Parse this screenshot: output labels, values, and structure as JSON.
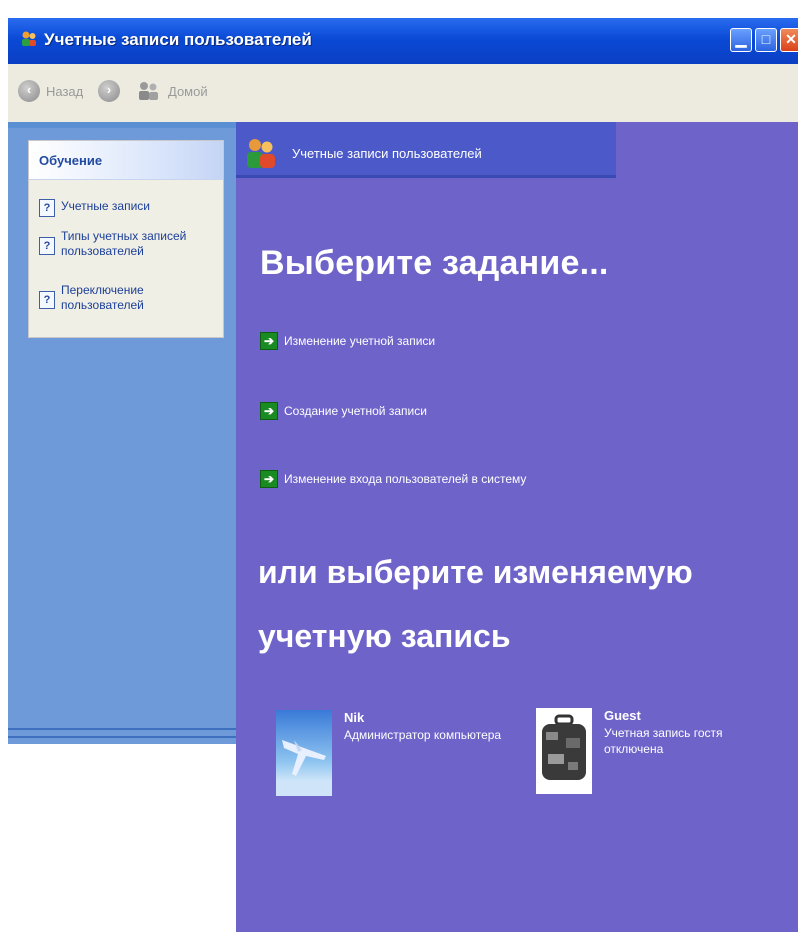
{
  "window": {
    "title": "Учетные записи пользователей",
    "min_glyph": "▁",
    "max_glyph": "□",
    "close_glyph": "✕"
  },
  "toolbar": {
    "back_label": "Назад",
    "forward_label": "",
    "home_label": "Домой"
  },
  "sidebar": {
    "learn_header": "Обучение",
    "items": [
      {
        "label": "Учетные записи"
      },
      {
        "label": "Типы учетных записей пользователей"
      },
      {
        "label": "Переключение пользователей"
      }
    ]
  },
  "main": {
    "header_title": "Учетные записи пользователей",
    "task_heading": "Выберите задание...",
    "tasks": [
      {
        "label": "Изменение учетной записи"
      },
      {
        "label": "Создание учетной записи"
      },
      {
        "label": "Изменение входа пользователей в систему"
      }
    ],
    "account_heading": "или выберите изменяемую учетную запись",
    "accounts": [
      {
        "name": "Nik",
        "description": "Администратор компьютера"
      },
      {
        "name": "Guest",
        "description": "Учетная запись гостя отключена"
      }
    ]
  },
  "colors": {
    "titlebar": "#0a4ad6",
    "toolbar": "#edebe0",
    "sidebar": "#6e9ad9",
    "main_bg": "#6d63c9",
    "header_bg": "#4b5ac8",
    "task_arrow": "#1a8a22"
  },
  "icons": [
    "users-icon",
    "back-icon",
    "forward-icon",
    "home-users-icon",
    "help-icon",
    "green-arrow-icon",
    "airplane-avatar",
    "suitcase-avatar"
  ]
}
